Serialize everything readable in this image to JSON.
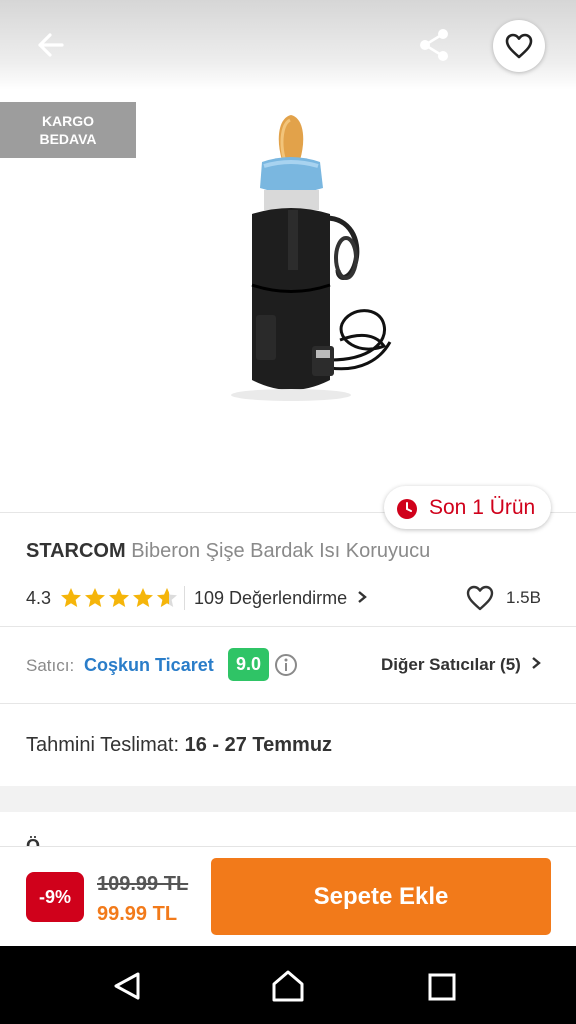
{
  "header": {
    "back_icon": "arrow-left-icon",
    "share_icon": "share-icon",
    "favorite_icon": "heart-outline-icon"
  },
  "badge": {
    "cargo_line1": "KARGO",
    "cargo_line2": "BEDAVA"
  },
  "stock": {
    "icon": "clock-icon",
    "text": "Son 1 Ürün",
    "color": "#d0011b"
  },
  "product": {
    "brand": "STARCOM",
    "name": "Biberon Şişe Bardak Isı Koruyucu",
    "rating": "4.3",
    "rating_value": 4.3,
    "reviews": "109 Değerlendirme",
    "likes": "1.5B"
  },
  "seller": {
    "label": "Satıcı:",
    "name": "Coşkun Ticaret",
    "score": "9.0",
    "score_color": "#2fc466",
    "other": "Diğer Satıcılar (5)"
  },
  "delivery": {
    "label": "Tahmini Teslimat:",
    "date": "16 - 27 Temmuz"
  },
  "partial_section": "Ö...",
  "bottom": {
    "discount": "-9%",
    "old_price": "109.99 TL",
    "new_price": "99.99 TL",
    "add_to_cart": "Sepete Ekle",
    "accent": "#f27a1a"
  }
}
